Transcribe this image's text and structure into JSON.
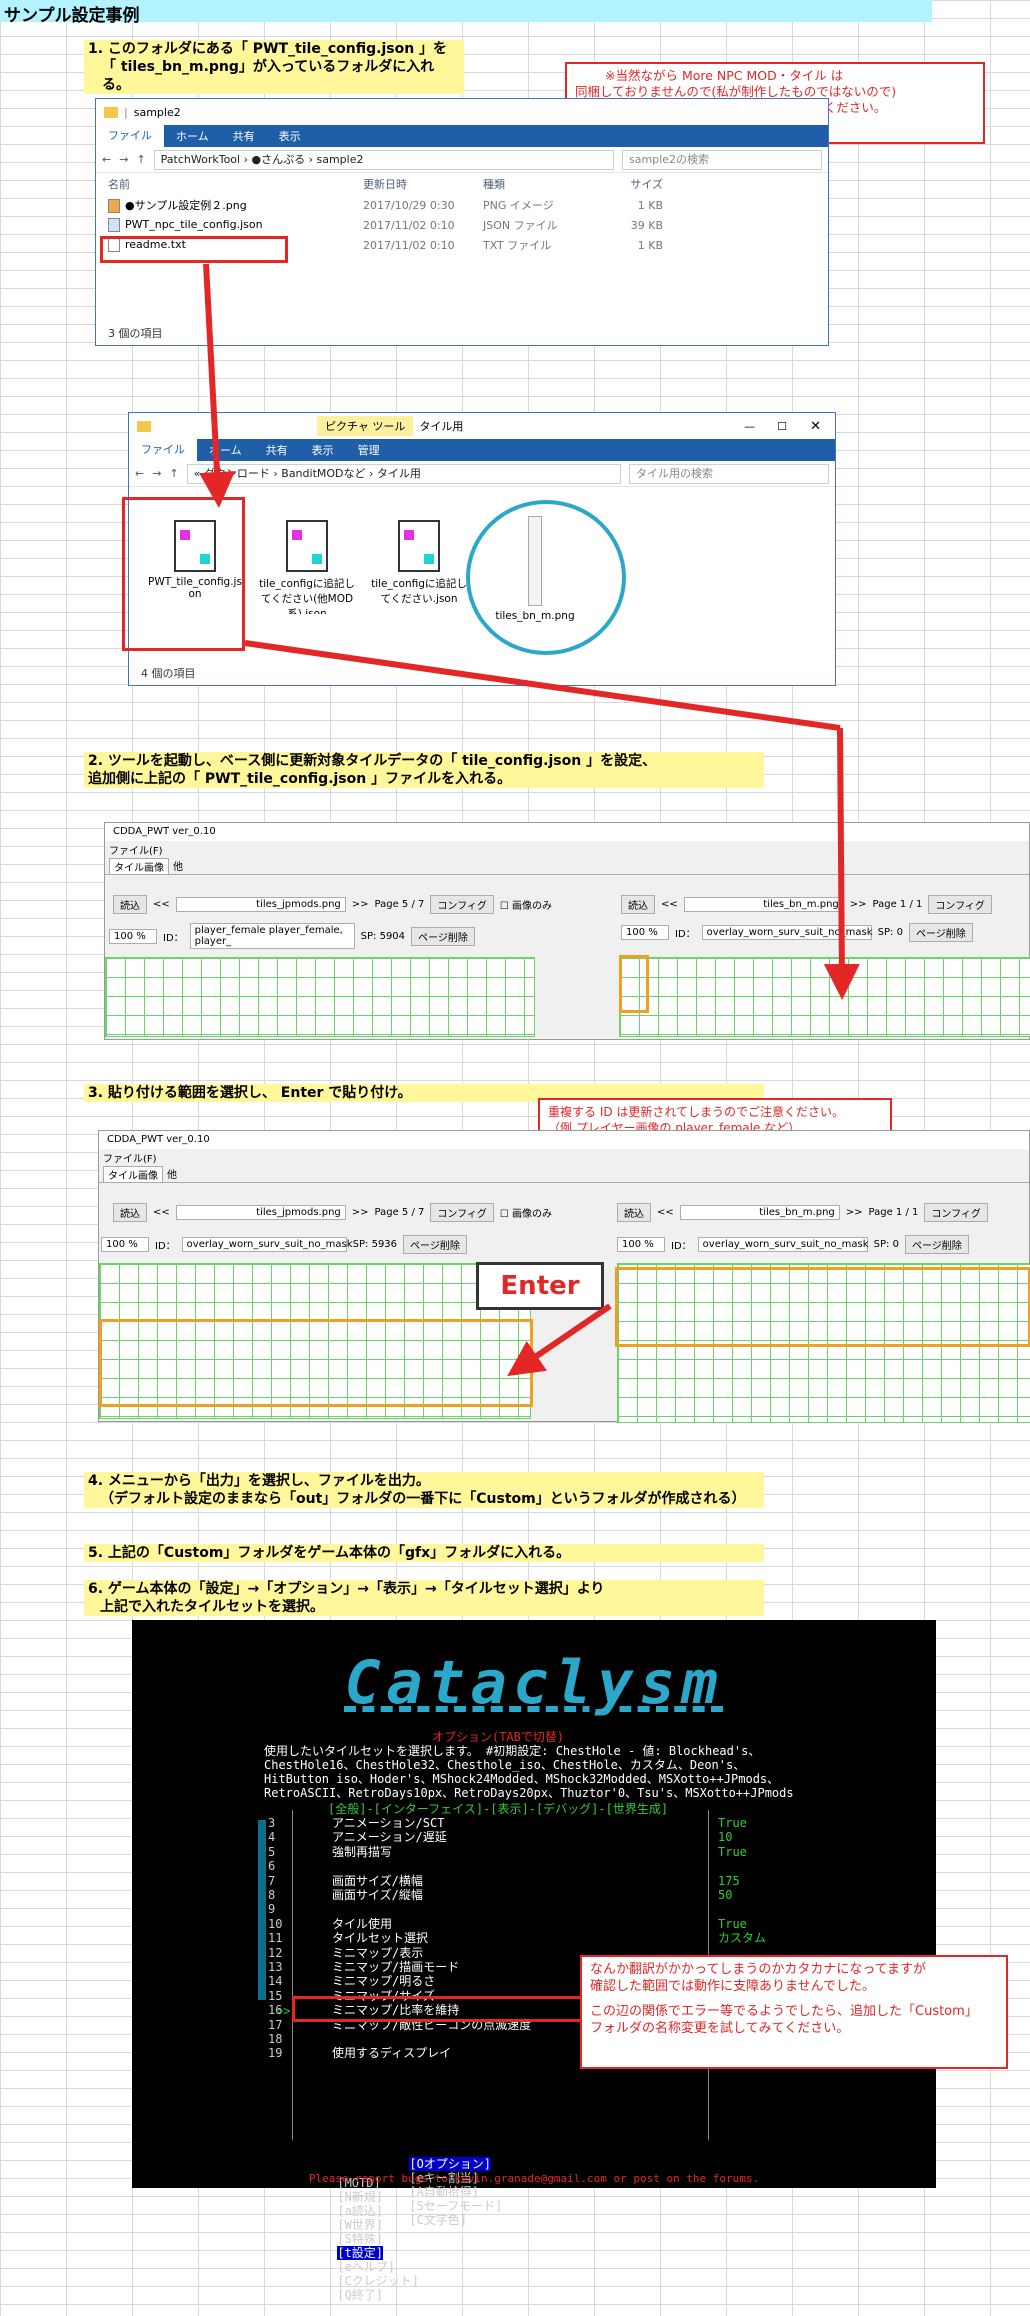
{
  "sheet_title": "サンプル設定事例",
  "steps": {
    "s1_line1": "1. このフォルダにある「 PWT_tile_config.json 」を",
    "s1_line2": "「 tiles_bn_m.png」が入っているフォルダに入れる。",
    "s2_line1": "2. ツールを起動し、ベース側に更新対象タイルデータの「 tile_config.json 」を設定、",
    "s2_line2": "追加側に上記の「 PWT_tile_config.json 」ファイルを入れる。",
    "s3": "3. 貼り付ける範囲を選択し、 Enter で貼り付け。",
    "s4_line1": "4. メニューから「出力」を選択し、ファイルを出力。",
    "s4_line2": "（デフォルト設定のままなら「out」フォルダの一番下に「Custom」というフォルダが作成される）",
    "s5": "5. 上記の「Custom」フォルダをゲーム本体の「gfx」フォルダに入れる。",
    "s6_line1": "6. ゲーム本体の「設定」→「オプション」→「表示」→「タイルセット選択」より",
    "s6_line2": "上記で入れたタイルセットを選択。"
  },
  "notes": {
    "note1_line1": "※当然ながら More NPC MOD・タイル は",
    "note1_line2": "同梱しておりませんので(私が制作したものではないので)",
    "note1_line3": "その辺は別途自身で探してダウンロードしてください。",
    "note2_line1": "重複する ID は更新されてしまうのでご注意ください。",
    "note2_line2": "（例 プレイヤー画像の player_female など）",
    "note3_line1": "なんか翻訳がかかってしまうのかカタカナになってますが",
    "note3_line2": "確認した範囲では動作に支障ありませんでした。",
    "note3_line3": "この辺の関係でエラー等でるようでしたら、追加した「Custom」",
    "note3_line4": "フォルダの名称変更を試してみてください。",
    "enter_label": "Enter"
  },
  "explorer1": {
    "title": "sample2",
    "tabs": [
      "ファイル",
      "ホーム",
      "共有",
      "表示"
    ],
    "path": "PatchWorkTool › ●さんぷる › sample2",
    "search_placeholder": "sample2の検索",
    "columns": [
      "名前",
      "更新日時",
      "種類",
      "サイズ"
    ],
    "files": [
      {
        "name": "●サンプル設定例２.png",
        "date": "2017/10/29 0:30",
        "type": "PNG イメージ",
        "size": "1 KB"
      },
      {
        "name": "PWT_npc_tile_config.json",
        "date": "2017/11/02 0:10",
        "type": "JSON ファイル",
        "size": "39 KB"
      },
      {
        "name": "readme.txt",
        "date": "2017/11/02 0:10",
        "type": "TXT ファイル",
        "size": "1 KB"
      }
    ],
    "status": "3 個の項目"
  },
  "explorer2": {
    "title": "タイル用",
    "context_tab": "ピクチャ ツール",
    "tabs": [
      "ファイル",
      "ホーム",
      "共有",
      "表示",
      "管理"
    ],
    "path": "« ダウンロード › BanditMODなど › タイル用",
    "search_placeholder": "タイル用の検索",
    "items": [
      {
        "name": "PWT_tile_config.json"
      },
      {
        "name": "tile_configに追記してください(他MOD系).json"
      },
      {
        "name": "tile_configに追記してください.json"
      },
      {
        "name": "tiles_bn_m.png"
      }
    ],
    "status": "4 個の項目"
  },
  "tool1": {
    "title": "CDDA_PWT  ver_0.10",
    "menu": "ファイル(F)",
    "tabs": [
      "タイル画像",
      "他"
    ],
    "left": {
      "load": "読込",
      "nav": "<<",
      "file": "tiles_jpmods.png",
      "nav2": ">>",
      "page": "Page 5 / 7",
      "config": "コンフィグ",
      "imgonly": "画像のみ",
      "zoom": "100 %",
      "id_label": "ID：",
      "id": "player_female  player_female, player_",
      "sp": "SP: 5904",
      "del": "ページ削除"
    },
    "right": {
      "load": "読込",
      "nav": "<<",
      "file": "tiles_bn_m.png",
      "nav2": ">>",
      "page": "Page 1 / 1",
      "config": "コンフィグ",
      "zoom": "100 %",
      "id_label": "ID：",
      "id": "overlay_worn_surv_suit_no_mask",
      "sp": "SP: 0",
      "del": "ページ削除"
    }
  },
  "tool2": {
    "title": "CDDA_PWT  ver_0.10",
    "menu": "ファイル(F)",
    "tabs": [
      "タイル画像",
      "他"
    ],
    "left": {
      "load": "読込",
      "nav": "<<",
      "file": "tiles_jpmods.png",
      "nav2": ">>",
      "page": "Page 5 / 7",
      "config": "コンフィグ",
      "imgonly": "画像のみ",
      "zoom": "100 %",
      "id_label": "ID：",
      "id": "overlay_worn_surv_suit_no_mask",
      "sp": "SP: 5936",
      "del": "ページ削除"
    },
    "right": {
      "load": "読込",
      "nav": "<<",
      "file": "tiles_bn_m.png",
      "nav2": ">>",
      "page": "Page 1 / 1",
      "config": "コンフィグ",
      "zoom": "100 %",
      "id_label": "ID：",
      "id": "overlay_worn_surv_suit_no_mask",
      "sp": "SP: 0",
      "del": "ページ削除"
    }
  },
  "game": {
    "logo": "Cataclysm",
    "options_header": "オプション(TABで切替)",
    "desc1": "使用したいタイルセットを選択します。 #初期設定: ChestHole - 値: Blockhead's、",
    "desc2": "ChestHole16、ChestHole32、Chesthole_iso、ChestHole、カスタム、Deon's、",
    "desc3": "HitButton iso、Hoder's、MShock24Modded、MShock32Modded、MSXotto++JPmods、",
    "desc4": "RetroASCII、RetroDays10px、RetroDays20px、Thuztor'0、Tsu's、MSXotto++JPmods",
    "tabs": "[全般]-[インターフェイス]-[表示]-[デバッグ]-[世界生成]",
    "rows": [
      {
        "n": "3",
        "label": "アニメーション/SCT",
        "val": "True"
      },
      {
        "n": "4",
        "label": "アニメーション/遅延",
        "val": "10"
      },
      {
        "n": "5",
        "label": "強制再描写",
        "val": "True"
      },
      {
        "n": "6",
        "label": "",
        "val": ""
      },
      {
        "n": "7",
        "label": "画面サイズ/横幅",
        "val": "175"
      },
      {
        "n": "8",
        "label": "画面サイズ/縦幅",
        "val": "50"
      },
      {
        "n": "9",
        "label": "",
        "val": ""
      },
      {
        "n": "10",
        "label": "タイル使用",
        "val": "True"
      },
      {
        "n": "11",
        "label": "タイルセット選択",
        "val": "カスタム"
      },
      {
        "n": "12",
        "label": "ミニマップ/表示",
        "val": ""
      },
      {
        "n": "13",
        "label": "ミニマップ/描画モード",
        "val": ""
      },
      {
        "n": "14",
        "label": "ミニマップ/明るさ",
        "val": ""
      },
      {
        "n": "15",
        "label": "ミニマップ/サイズ",
        "val": ""
      },
      {
        "n": "16",
        "label": "ミニマップ/比率を維持",
        "val": ""
      },
      {
        "n": "17",
        "label": "ミニマップ/敵性ビーコンの点滅速度",
        "val": ""
      },
      {
        "n": "18",
        "label": "",
        "val": ""
      },
      {
        "n": "19",
        "label": "使用するディスプレイ",
        "val": ""
      }
    ],
    "cursor": ">>",
    "menu1": [
      "[Oオプション]",
      "[eキー割当]",
      "[A自動拾得]",
      "[Sセーフモード]",
      "[C文字色]"
    ],
    "menu2": [
      "[MOTD]",
      "[N新規]",
      "[a読込]",
      "[W世界]",
      "[S特殊]",
      "[t設定]",
      "[eヘルプ]",
      "[Cクレジット]",
      "[Q終了]"
    ],
    "footer": "Please report bugs to kevin.granade@gmail.com or post on the forums.",
    "colors": {
      "green": "#33cc33",
      "highlight": "#0000cc",
      "cyan": "#2aa7c9",
      "red": "#e32626"
    }
  }
}
